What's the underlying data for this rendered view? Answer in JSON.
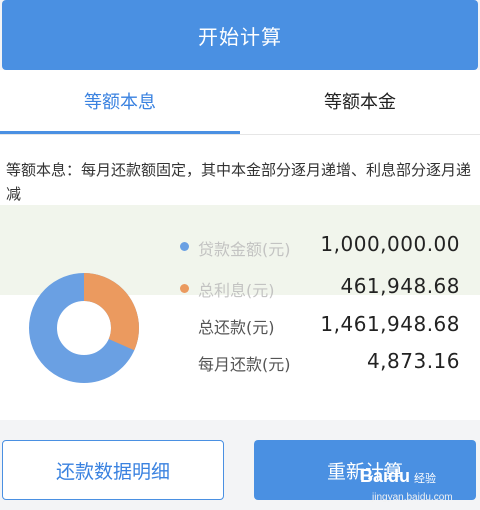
{
  "calculate_button": {
    "label": "开始计算"
  },
  "tabs": [
    {
      "label": "等额本息",
      "active": true
    },
    {
      "label": "等额本金",
      "active": false
    }
  ],
  "description": "等额本息：每月还款额固定，其中本金部分逐月递增、利息部分逐月递减",
  "summary": [
    {
      "label": "贷款金额(元)",
      "value": "1,000,000.00"
    },
    {
      "label": "总利息(元)",
      "value": "461,948.68"
    },
    {
      "label": "总还款(元)",
      "value": "1,461,948.68"
    },
    {
      "label": "每月还款(元)",
      "value": "4,873.16"
    }
  ],
  "donut": {
    "principal_share": 0.684,
    "interest_share": 0.316,
    "colors": {
      "principal": "#6aa0e3",
      "interest": "#eb9a5f"
    }
  },
  "buttons": {
    "details": "还款数据明细",
    "recalculate": "重新计算"
  },
  "watermark": {
    "brand": "Baidu",
    "sub": "经验",
    "url": "jingyan.baidu.com"
  },
  "colors": {
    "accent": "#4a90e2"
  }
}
